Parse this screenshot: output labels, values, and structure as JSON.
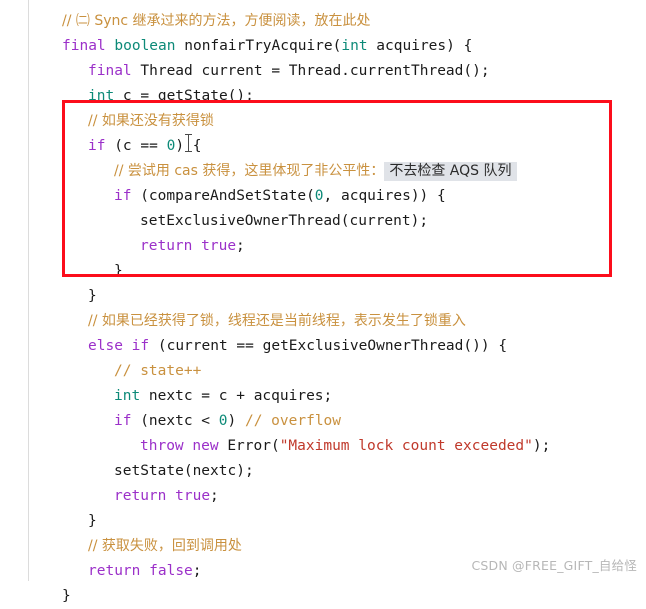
{
  "editor": {
    "language": "java",
    "colors": {
      "comment": "#c9913f",
      "keyword": "#9b30c9",
      "type": "#0d8a78",
      "string": "#c0392b",
      "plain": "#1a1a1a",
      "background": "#ffffff",
      "annotation_red": "#fc0d1b",
      "highlight_grey": "#e0e3e8",
      "watermark": "#b7b7b7"
    },
    "lines": [
      {
        "n": 1,
        "indent": 0,
        "tokens": [
          {
            "t": "comment",
            "v": "// ㈡ Sync 继承过来的方法，方便阅读，放在此处"
          }
        ]
      },
      {
        "n": 2,
        "indent": 0,
        "tokens": [
          {
            "t": "keyword",
            "v": "final"
          },
          {
            "t": "plain",
            "v": " "
          },
          {
            "t": "type",
            "v": "boolean"
          },
          {
            "t": "plain",
            "v": " nonfairTryAcquire("
          },
          {
            "t": "type",
            "v": "int"
          },
          {
            "t": "plain",
            "v": " acquires) {"
          }
        ]
      },
      {
        "n": 3,
        "indent": 1,
        "tokens": [
          {
            "t": "keyword",
            "v": "final"
          },
          {
            "t": "plain",
            "v": " Thread current = Thread.currentThread();"
          }
        ]
      },
      {
        "n": 4,
        "indent": 1,
        "tokens": [
          {
            "t": "type",
            "v": "int"
          },
          {
            "t": "plain",
            "v": " c = getState();"
          }
        ]
      },
      {
        "n": 5,
        "indent": 1,
        "tokens": [
          {
            "t": "comment",
            "v": "// 如果还没有获得锁"
          }
        ]
      },
      {
        "n": 6,
        "indent": 1,
        "tokens": [
          {
            "t": "keyword",
            "v": "if"
          },
          {
            "t": "plain",
            "v": " (c == "
          },
          {
            "t": "num",
            "v": "0"
          },
          {
            "t": "plain",
            "v": ") {"
          }
        ]
      },
      {
        "n": 7,
        "indent": 2,
        "tokens": [
          {
            "t": "comment",
            "v": "// 尝试用 cas 获得，这里体现了非公平性："
          },
          {
            "t": "highlight",
            "v": "不去检查 AQS 队列"
          }
        ]
      },
      {
        "n": 8,
        "indent": 2,
        "tokens": [
          {
            "t": "keyword",
            "v": "if"
          },
          {
            "t": "plain",
            "v": " (compareAndSetState("
          },
          {
            "t": "num",
            "v": "0"
          },
          {
            "t": "plain",
            "v": ", acquires)) {"
          }
        ]
      },
      {
        "n": 9,
        "indent": 3,
        "tokens": [
          {
            "t": "plain",
            "v": "setExclusiveOwnerThread(current);"
          }
        ]
      },
      {
        "n": 10,
        "indent": 3,
        "tokens": [
          {
            "t": "keyword",
            "v": "return"
          },
          {
            "t": "plain",
            "v": " "
          },
          {
            "t": "keyword",
            "v": "true"
          },
          {
            "t": "plain",
            "v": ";"
          }
        ]
      },
      {
        "n": 11,
        "indent": 2,
        "tokens": [
          {
            "t": "plain",
            "v": "}"
          }
        ]
      },
      {
        "n": 12,
        "indent": 1,
        "tokens": [
          {
            "t": "plain",
            "v": "}"
          }
        ]
      },
      {
        "n": 13,
        "indent": 1,
        "tokens": [
          {
            "t": "comment",
            "v": "// 如果已经获得了锁，线程还是当前线程，表示发生了锁重入"
          }
        ]
      },
      {
        "n": 14,
        "indent": 1,
        "tokens": [
          {
            "t": "keyword",
            "v": "else"
          },
          {
            "t": "plain",
            "v": " "
          },
          {
            "t": "keyword",
            "v": "if"
          },
          {
            "t": "plain",
            "v": " (current == getExclusiveOwnerThread()) {"
          }
        ]
      },
      {
        "n": 15,
        "indent": 2,
        "tokens": [
          {
            "t": "comment",
            "v": "// state++"
          }
        ]
      },
      {
        "n": 16,
        "indent": 2,
        "tokens": [
          {
            "t": "type",
            "v": "int"
          },
          {
            "t": "plain",
            "v": " nextc = c + acquires;"
          }
        ]
      },
      {
        "n": 17,
        "indent": 2,
        "tokens": [
          {
            "t": "keyword",
            "v": "if"
          },
          {
            "t": "plain",
            "v": " (nextc < "
          },
          {
            "t": "num",
            "v": "0"
          },
          {
            "t": "plain",
            "v": ") "
          },
          {
            "t": "comment",
            "v": "// overflow"
          }
        ]
      },
      {
        "n": 18,
        "indent": 3,
        "tokens": [
          {
            "t": "keyword",
            "v": "throw"
          },
          {
            "t": "plain",
            "v": " "
          },
          {
            "t": "keyword",
            "v": "new"
          },
          {
            "t": "plain",
            "v": " Error("
          },
          {
            "t": "string",
            "v": "\"Maximum lock count exceeded\""
          },
          {
            "t": "plain",
            "v": ");"
          }
        ]
      },
      {
        "n": 19,
        "indent": 2,
        "tokens": [
          {
            "t": "plain",
            "v": "setState(nextc);"
          }
        ]
      },
      {
        "n": 20,
        "indent": 2,
        "tokens": [
          {
            "t": "keyword",
            "v": "return"
          },
          {
            "t": "plain",
            "v": " "
          },
          {
            "t": "keyword",
            "v": "true"
          },
          {
            "t": "plain",
            "v": ";"
          }
        ]
      },
      {
        "n": 21,
        "indent": 1,
        "tokens": [
          {
            "t": "plain",
            "v": "}"
          }
        ]
      },
      {
        "n": 22,
        "indent": 1,
        "tokens": [
          {
            "t": "comment",
            "v": "// 获取失败，回到调用处"
          }
        ]
      },
      {
        "n": 23,
        "indent": 1,
        "tokens": [
          {
            "t": "keyword",
            "v": "return"
          },
          {
            "t": "plain",
            "v": " "
          },
          {
            "t": "keyword",
            "v": "false"
          },
          {
            "t": "plain",
            "v": ";"
          }
        ]
      },
      {
        "n": 24,
        "indent": 0,
        "tokens": [
          {
            "t": "plain",
            "v": "}"
          }
        ]
      }
    ]
  },
  "annotation": {
    "type": "red-rectangle",
    "covers_lines": "5-12",
    "color": "#fc0d1b"
  },
  "watermark": {
    "text": "CSDN @FREE_GIFT_自给怪"
  }
}
